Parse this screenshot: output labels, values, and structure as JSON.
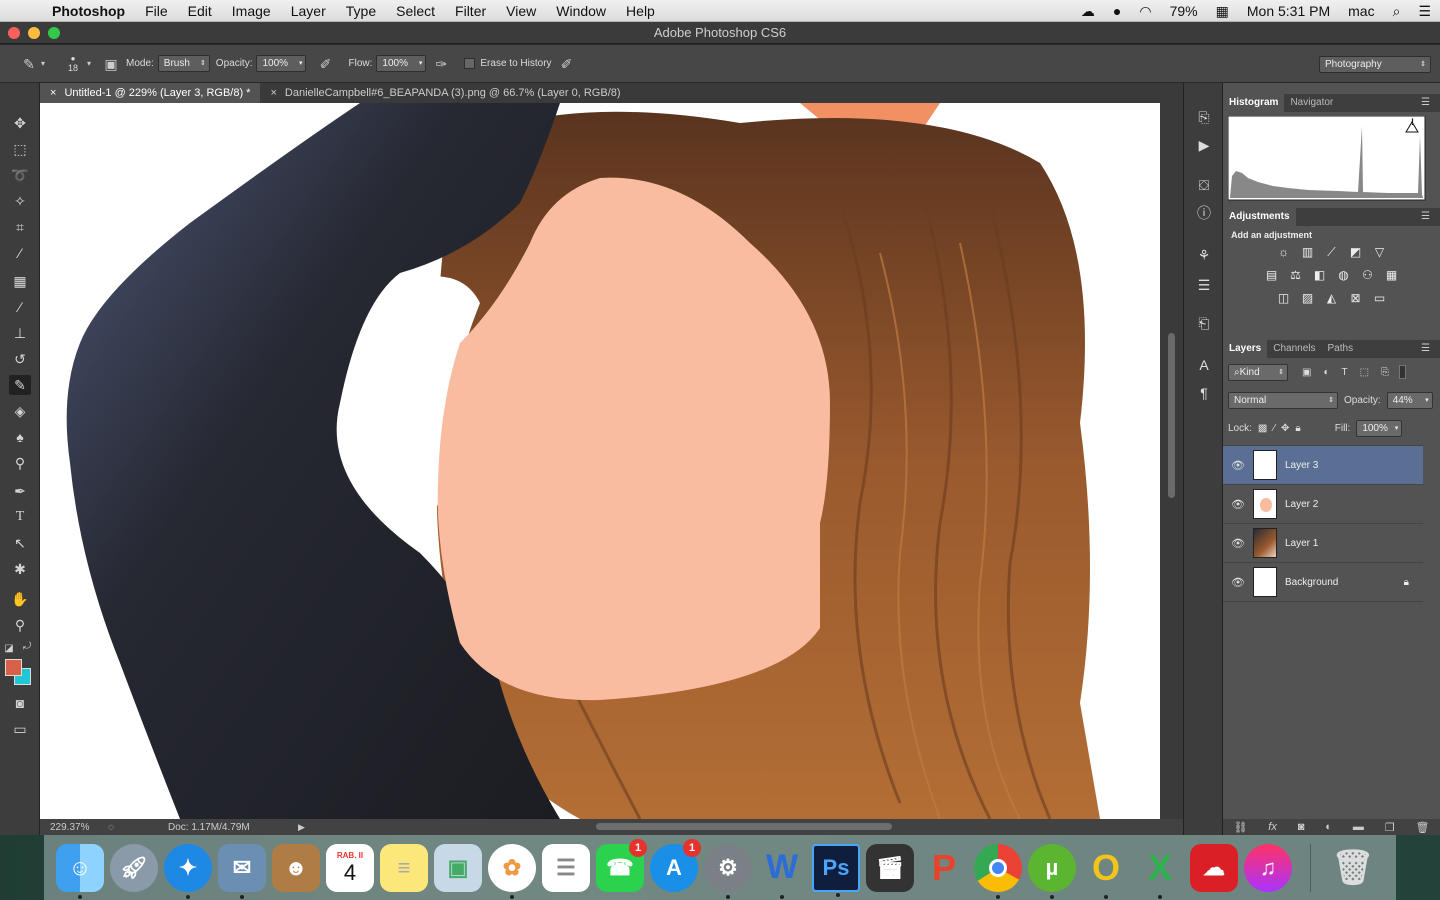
{
  "menubar": {
    "app_name": "Photoshop",
    "items": [
      "File",
      "Edit",
      "Image",
      "Layer",
      "Type",
      "Select",
      "Filter",
      "View",
      "Window",
      "Help"
    ],
    "battery": "79%",
    "clock": "Mon 5:31 PM",
    "user": "mac"
  },
  "window": {
    "title": "Adobe Photoshop CS6"
  },
  "options": {
    "brush_size": "18",
    "mode_label": "Mode:",
    "mode_value": "Brush",
    "opacity_label": "Opacity:",
    "opacity_value": "100%",
    "flow_label": "Flow:",
    "flow_value": "100%",
    "erase_history_label": "Erase to History",
    "workspace": "Photography"
  },
  "tabs": [
    {
      "label": "Untitled-1 @ 229% (Layer 3, RGB/8) *"
    },
    {
      "label": "DanielleCampbell#6_BEAPANDA (3).png @ 66.7% (Layer 0, RGB/8)"
    }
  ],
  "status": {
    "zoom": "229.37%",
    "doc": "Doc: 1.17M/4.79M"
  },
  "panels": {
    "histogram_tab": "Histogram",
    "navigator_tab": "Navigator",
    "adjustments_tab": "Adjustments",
    "add_adjustment": "Add an adjustment",
    "layers_tab": "Layers",
    "channels_tab": "Channels",
    "paths_tab": "Paths",
    "kind_filter": "Kind",
    "blend_mode": "Normal",
    "opacity_label": "Opacity:",
    "opacity_value": "44%",
    "lock_label": "Lock:",
    "fill_label": "Fill:",
    "fill_value": "100%"
  },
  "layers": [
    {
      "name": "Layer 3",
      "selected": true
    },
    {
      "name": "Layer 2",
      "selected": false
    },
    {
      "name": "Layer 1",
      "selected": false
    },
    {
      "name": "Background",
      "selected": false,
      "locked": true
    }
  ],
  "dock": {
    "calendar_month": "RAB. II",
    "calendar_day": "4",
    "facetime_badge": "1",
    "appstore_badge": "1",
    "ps_label": "Ps"
  },
  "colors": {
    "foreground": "#d9614a",
    "background": "#1ec6d6",
    "face": "#f9bca0",
    "selected_layer": "#5a6f93"
  }
}
